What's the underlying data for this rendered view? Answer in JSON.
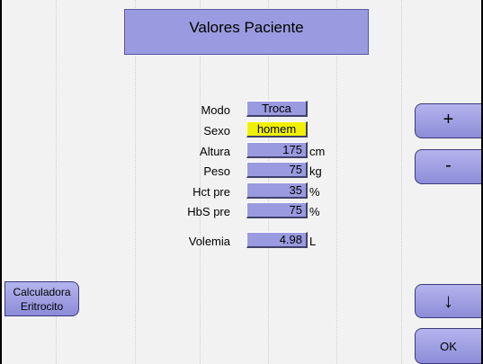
{
  "title": "Valores Paciente",
  "fields": [
    {
      "label": "Modo",
      "value": "Troca",
      "unit": ""
    },
    {
      "label": "Sexo",
      "value": "homem",
      "unit": ""
    },
    {
      "label": "Altura",
      "value": "175",
      "unit": "cm"
    },
    {
      "label": "Peso",
      "value": "75",
      "unit": "kg"
    },
    {
      "label": "Hct pre",
      "value": "35",
      "unit": "%"
    },
    {
      "label": "HbS pre",
      "value": "75",
      "unit": "%"
    },
    {
      "label": "Volemia",
      "value": "4.98",
      "unit": "L"
    }
  ],
  "buttons": {
    "plus": "+",
    "minus": "-",
    "down": "↓",
    "ok": "OK",
    "calc_line1": "Calculadora",
    "calc_line2": "Eritrocito"
  },
  "colors": {
    "field": "#9a9ae0",
    "highlight": "#f0f000",
    "background": "#f2f2f2"
  }
}
